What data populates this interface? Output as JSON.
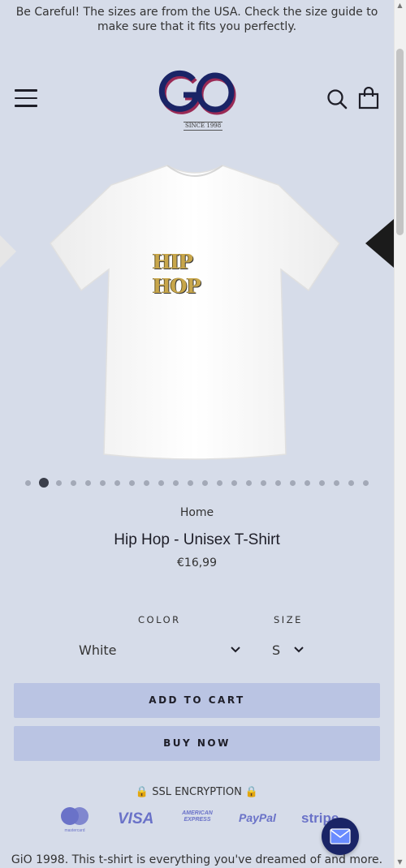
{
  "announcement": "Be Careful! The sizes are from the USA. Check the size guide to make sure that it fits you perfectly.",
  "header": {
    "logo_text": "GO",
    "logo_since": "SINCE 1998",
    "icons": [
      "menu-icon",
      "search-icon",
      "cart-icon"
    ]
  },
  "gallery": {
    "print_text": "HIP HOP",
    "slide_count": 24,
    "active_slide": 2
  },
  "breadcrumb": "Home",
  "product": {
    "title": "Hip Hop - Unisex T-Shirt",
    "price": "€16,99"
  },
  "options": {
    "color_label": "COLOR",
    "color_value": "White",
    "size_label": "SIZE",
    "size_value": "S"
  },
  "buttons": {
    "add_to_cart": "ADD TO CART",
    "buy_now": "BUY NOW"
  },
  "ssl": "🔒 SSL ENCRYPTION 🔒",
  "payments": {
    "mastercard": "mastercard",
    "visa": "VISA",
    "amex": "AMERICAN EXPRESS",
    "paypal": "PayPal",
    "stripe": "stripe"
  },
  "description": "GiO 1998. This t-shirt is everything you've dreamed of and more.",
  "colors": {
    "background": "#d6dce9",
    "button": "#bac4e3",
    "logo": "#1a2466",
    "logo_accent": "#9a2a55",
    "payment": "#6a72c8"
  }
}
